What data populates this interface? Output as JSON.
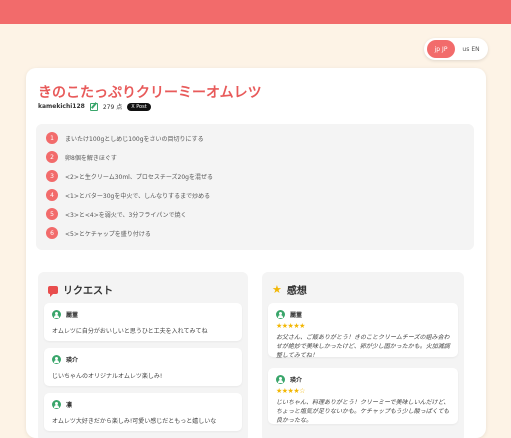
{
  "lang_toggle": {
    "jp": {
      "flag": "jp",
      "label": "JP"
    },
    "en": {
      "flag": "us",
      "label": "EN"
    }
  },
  "recipe": {
    "title": "きのこたっぷりクリーミーオムレツ",
    "author": "kamekichi128",
    "points": "279 点",
    "share_label": "X Post"
  },
  "steps": [
    {
      "num": "1",
      "text": "まいたけ100gとしめじ100gをさいの目切りにする"
    },
    {
      "num": "2",
      "text": "卵8個を解きほぐす"
    },
    {
      "num": "3",
      "text": "<2>と生クリーム30ml、プロセスチーズ20gを混ぜる"
    },
    {
      "num": "4",
      "text": "<1>とバター30gを中火で、しんなりするまで炒める"
    },
    {
      "num": "5",
      "text": "<3>と<4>を弱火で、3分フライパンで焼く"
    },
    {
      "num": "6",
      "text": "<5>とケチャップを盛り付ける"
    }
  ],
  "requests": {
    "title": "リクエスト",
    "items": [
      {
        "user": "麗菫",
        "text": "オムレツに自分がおいしいと思うひと工夫を入れてみてね"
      },
      {
        "user": "瑛介",
        "text": "じいちゃんのオリジナルオムレツ楽しみ!"
      },
      {
        "user": "凛",
        "text": "オムレツ大好きだから楽しみ!可愛い感じだともっと嬉しいな"
      }
    ]
  },
  "reviews": {
    "title": "感想",
    "items": [
      {
        "user": "麗菫",
        "rating": 5,
        "stars": "★★★★★",
        "text": "お父さん、ご飯ありがとう！きのことクリームチーズの組み合わせが絶妙で美味しかったけど、卵が少し固かったかも。火加減調整してみてね！"
      },
      {
        "user": "瑛介",
        "rating": 4,
        "stars": "★★★★☆",
        "text": "じいちゃん、料理ありがとう！クリーミーで美味しいんだけど、ちょっと塩気が足りないかも。ケチャップもう少し酸っぱくても良かったな。"
      }
    ]
  },
  "colors": {
    "accent": "#f26b6b",
    "title": "#e85a5a",
    "user_icon": "#3aa66b",
    "star": "#f2b705",
    "background": "#fdf3e6"
  }
}
